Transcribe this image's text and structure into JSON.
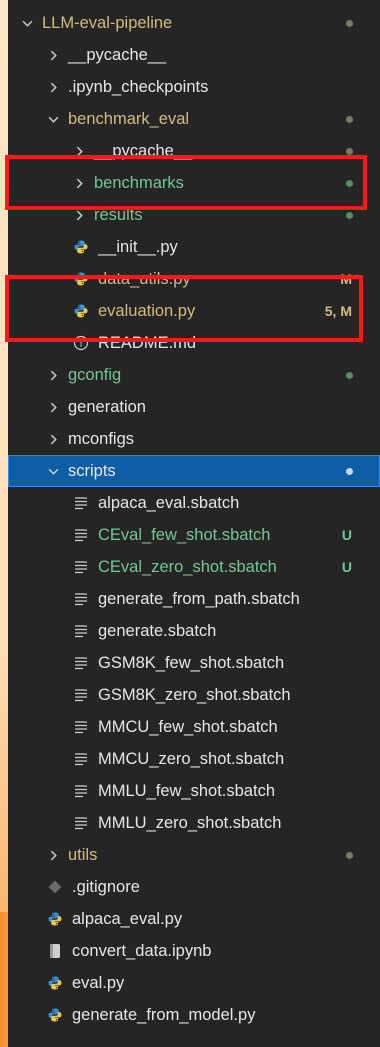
{
  "colors": {
    "modified": "#d7ba7d",
    "untracked": "#73c991",
    "dot_dim": "#7a7a5a",
    "dot_green": "#5b8a5b",
    "highlight": "#ff1a1a",
    "selected": "#0e5ea6"
  },
  "tree": [
    {
      "label": "LLM-eval-pipeline",
      "type": "folder-open",
      "depth": 0,
      "color": "modified",
      "dot": "dim"
    },
    {
      "label": "__pycache__",
      "type": "folder",
      "depth": 1
    },
    {
      "label": ".ipynb_checkpoints",
      "type": "folder",
      "depth": 1
    },
    {
      "label": "benchmark_eval",
      "type": "folder-open",
      "depth": 1,
      "color": "modified",
      "dot": "dim"
    },
    {
      "label": "__pycache__",
      "type": "folder",
      "depth": 2,
      "dot": "dim"
    },
    {
      "label": "benchmarks",
      "type": "folder",
      "depth": 2,
      "color": "untracked",
      "dot": "green"
    },
    {
      "label": "results",
      "type": "folder",
      "depth": 2,
      "color": "untracked",
      "dot": "green"
    },
    {
      "label": "__init__.py",
      "type": "python-file",
      "depth": 2
    },
    {
      "label": "data_utils.py",
      "type": "python-file",
      "depth": 2,
      "color": "modified",
      "status": "M"
    },
    {
      "label": "evaluation.py",
      "type": "python-file",
      "depth": 2,
      "color": "modified",
      "status": "5, M"
    },
    {
      "label": "README.md",
      "type": "info-file",
      "depth": 2
    },
    {
      "label": "gconfig",
      "type": "folder",
      "depth": 1,
      "color": "untracked",
      "dot": "green"
    },
    {
      "label": "generation",
      "type": "folder",
      "depth": 1
    },
    {
      "label": "mconfigs",
      "type": "folder",
      "depth": 1
    },
    {
      "label": "scripts",
      "type": "folder-open",
      "depth": 1,
      "selected": true,
      "dot": "light"
    },
    {
      "label": "alpaca_eval.sbatch",
      "type": "text-file",
      "depth": 2
    },
    {
      "label": "CEval_few_shot.sbatch",
      "type": "text-file",
      "depth": 2,
      "color": "untracked",
      "status": "U"
    },
    {
      "label": "CEval_zero_shot.sbatch",
      "type": "text-file",
      "depth": 2,
      "color": "untracked",
      "status": "U"
    },
    {
      "label": "generate_from_path.sbatch",
      "type": "text-file",
      "depth": 2
    },
    {
      "label": "generate.sbatch",
      "type": "text-file",
      "depth": 2
    },
    {
      "label": "GSM8K_few_shot.sbatch",
      "type": "text-file",
      "depth": 2
    },
    {
      "label": "GSM8K_zero_shot.sbatch",
      "type": "text-file",
      "depth": 2
    },
    {
      "label": "MMCU_few_shot.sbatch",
      "type": "text-file",
      "depth": 2
    },
    {
      "label": "MMCU_zero_shot.sbatch",
      "type": "text-file",
      "depth": 2
    },
    {
      "label": "MMLU_few_shot.sbatch",
      "type": "text-file",
      "depth": 2
    },
    {
      "label": "MMLU_zero_shot.sbatch",
      "type": "text-file",
      "depth": 2
    },
    {
      "label": "utils",
      "type": "folder",
      "depth": 1,
      "color": "modified",
      "dot": "dim"
    },
    {
      "label": ".gitignore",
      "type": "git-file",
      "depth": 1
    },
    {
      "label": "alpaca_eval.py",
      "type": "python-file",
      "depth": 1
    },
    {
      "label": "convert_data.ipynb",
      "type": "notebook-file",
      "depth": 1
    },
    {
      "label": "eval.py",
      "type": "python-file",
      "depth": 1
    },
    {
      "label": "generate_from_model.py",
      "type": "python-file",
      "depth": 1
    }
  ]
}
